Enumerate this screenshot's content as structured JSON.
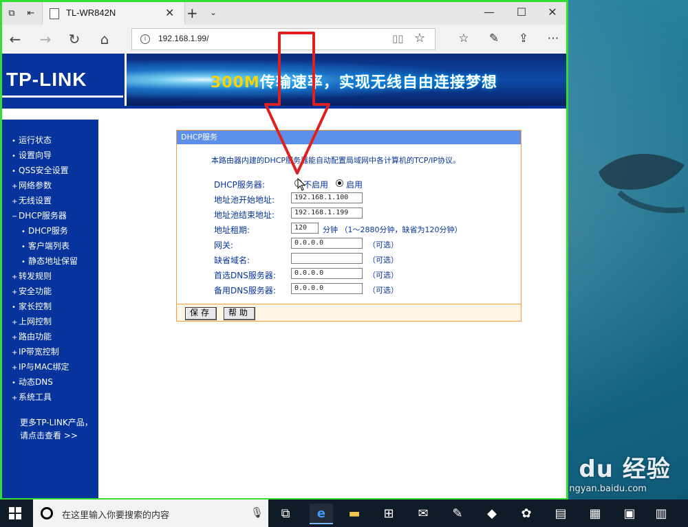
{
  "browser": {
    "tab_title": "TL-WR842N",
    "url": "192.168.1.99/",
    "tab_close": "✕",
    "new_tab": "+",
    "tab_menu": "⌄",
    "win_min": "—",
    "win_max": "☐",
    "win_close": "✕"
  },
  "router": {
    "logo": "TP-LINK",
    "banner": {
      "highlight": "300M",
      "text": "传输速率，实现无线自由连接梦想"
    },
    "menu": [
      {
        "bullet": "•",
        "label": "运行状态"
      },
      {
        "bullet": "•",
        "label": "设置向导"
      },
      {
        "bullet": "•",
        "label": "QSS安全设置"
      },
      {
        "bullet": "+",
        "label": "网络参数"
      },
      {
        "bullet": "+",
        "label": "无线设置"
      },
      {
        "bullet": "−",
        "label": "DHCP服务器"
      },
      {
        "bullet": "•",
        "label": "DHCP服务"
      },
      {
        "bullet": "•",
        "label": "客户端列表"
      },
      {
        "bullet": "•",
        "label": "静态地址保留"
      },
      {
        "bullet": "+",
        "label": "转发规则"
      },
      {
        "bullet": "+",
        "label": "安全功能"
      },
      {
        "bullet": "•",
        "label": "家长控制"
      },
      {
        "bullet": "+",
        "label": "上网控制"
      },
      {
        "bullet": "+",
        "label": "路由功能"
      },
      {
        "bullet": "+",
        "label": "IP带宽控制"
      },
      {
        "bullet": "+",
        "label": "IP与MAC绑定"
      },
      {
        "bullet": "•",
        "label": "动态DNS"
      },
      {
        "bullet": "+",
        "label": "系统工具"
      }
    ],
    "more_line1": "更多TP-LINK产品，",
    "more_line2": "请点击查看 >>"
  },
  "dhcp": {
    "title": "DHCP服务",
    "description": "本路由器内建的DHCP服务器能自动配置局域网中各计算机的TCP/IP协议。",
    "server_label": "DHCP服务器:",
    "option_off": "不启用",
    "option_on": "启用",
    "selected": "启用",
    "start_label": "地址池开始地址:",
    "start_value": "192.168.1.100",
    "end_label": "地址池结束地址:",
    "end_value": "192.168.1.199",
    "lease_label": "地址租期:",
    "lease_value": "120",
    "lease_note": "分钟 （1～2880分钟，缺省为120分钟）",
    "gateway_label": "网关:",
    "gateway_value": "0.0.0.0",
    "domain_label": "缺省域名:",
    "domain_value": "",
    "dns1_label": "首选DNS服务器:",
    "dns1_value": "0.0.0.0",
    "dns2_label": "备用DNS服务器:",
    "dns2_value": "0.0.0.0",
    "optional": "（可选）",
    "save_button": "保存",
    "help_button": "帮助"
  },
  "taskbar": {
    "search_placeholder": "在这里输入你要搜索的内容"
  },
  "watermark": {
    "logo": "Bai du 经验",
    "url": "jingyan.baidu.com"
  },
  "colors": {
    "page_blue": "#06349c",
    "panel_header": "#5b8fe8",
    "panel_border": "#f0a040",
    "window_border": "#33dd33",
    "arrow": "#e02020"
  }
}
